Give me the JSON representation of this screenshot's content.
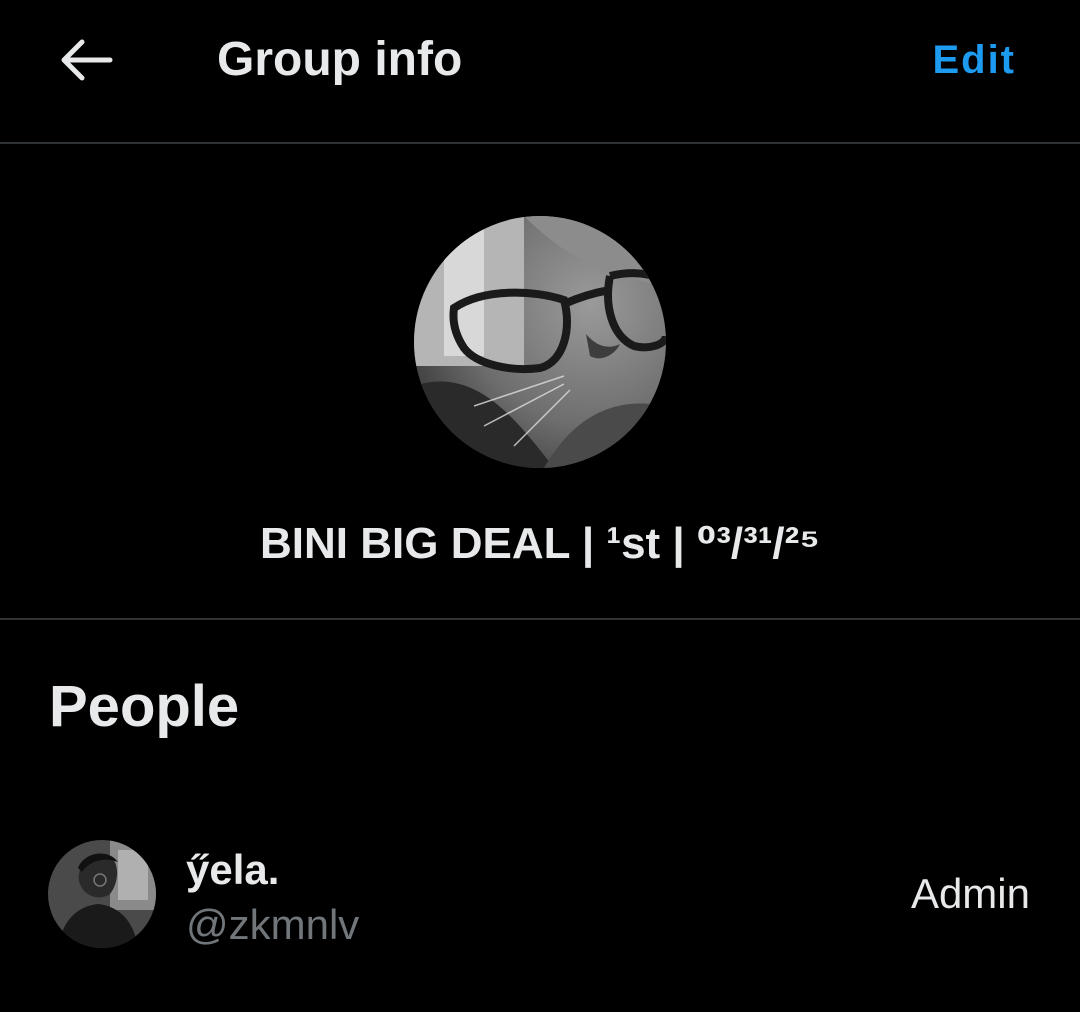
{
  "header": {
    "title": "Group info",
    "edit_label": "Edit"
  },
  "group": {
    "name": "BINI BIG DEAL  | ¹st | ⁰³/³¹/²⁵"
  },
  "people": {
    "heading": "People",
    "members": [
      {
        "display_name": "ӳela.",
        "handle": "@zkmnlv",
        "role": "Admin"
      }
    ]
  },
  "colors": {
    "background": "#000000",
    "text": "#e7e9ea",
    "secondary_text": "#71767b",
    "accent": "#1d9bf0",
    "divider": "#2f3336"
  },
  "icons": {
    "back": "arrow-left-icon"
  }
}
